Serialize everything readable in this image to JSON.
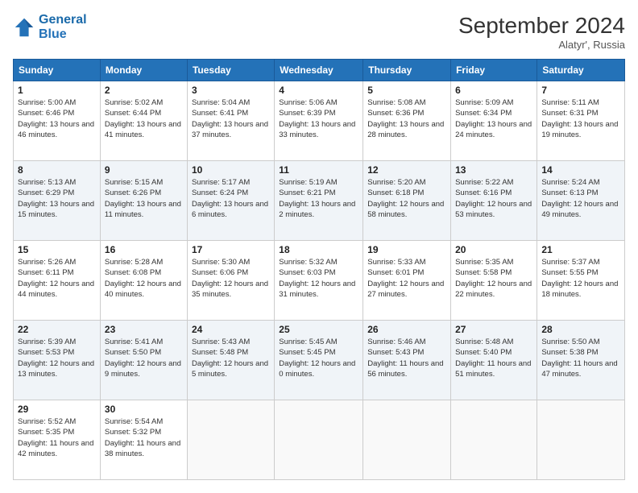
{
  "header": {
    "logo_line1": "General",
    "logo_line2": "Blue",
    "month_title": "September 2024",
    "subtitle": "Alatyr', Russia"
  },
  "weekdays": [
    "Sunday",
    "Monday",
    "Tuesday",
    "Wednesday",
    "Thursday",
    "Friday",
    "Saturday"
  ],
  "weeks": [
    [
      {
        "day": "1",
        "rise": "5:00 AM",
        "set": "6:46 PM",
        "daylight": "13 hours and 46 minutes."
      },
      {
        "day": "2",
        "rise": "5:02 AM",
        "set": "6:44 PM",
        "daylight": "13 hours and 41 minutes."
      },
      {
        "day": "3",
        "rise": "5:04 AM",
        "set": "6:41 PM",
        "daylight": "13 hours and 37 minutes."
      },
      {
        "day": "4",
        "rise": "5:06 AM",
        "set": "6:39 PM",
        "daylight": "13 hours and 33 minutes."
      },
      {
        "day": "5",
        "rise": "5:08 AM",
        "set": "6:36 PM",
        "daylight": "13 hours and 28 minutes."
      },
      {
        "day": "6",
        "rise": "5:09 AM",
        "set": "6:34 PM",
        "daylight": "13 hours and 24 minutes."
      },
      {
        "day": "7",
        "rise": "5:11 AM",
        "set": "6:31 PM",
        "daylight": "13 hours and 19 minutes."
      }
    ],
    [
      {
        "day": "8",
        "rise": "5:13 AM",
        "set": "6:29 PM",
        "daylight": "13 hours and 15 minutes."
      },
      {
        "day": "9",
        "rise": "5:15 AM",
        "set": "6:26 PM",
        "daylight": "13 hours and 11 minutes."
      },
      {
        "day": "10",
        "rise": "5:17 AM",
        "set": "6:24 PM",
        "daylight": "13 hours and 6 minutes."
      },
      {
        "day": "11",
        "rise": "5:19 AM",
        "set": "6:21 PM",
        "daylight": "13 hours and 2 minutes."
      },
      {
        "day": "12",
        "rise": "5:20 AM",
        "set": "6:18 PM",
        "daylight": "12 hours and 58 minutes."
      },
      {
        "day": "13",
        "rise": "5:22 AM",
        "set": "6:16 PM",
        "daylight": "12 hours and 53 minutes."
      },
      {
        "day": "14",
        "rise": "5:24 AM",
        "set": "6:13 PM",
        "daylight": "12 hours and 49 minutes."
      }
    ],
    [
      {
        "day": "15",
        "rise": "5:26 AM",
        "set": "6:11 PM",
        "daylight": "12 hours and 44 minutes."
      },
      {
        "day": "16",
        "rise": "5:28 AM",
        "set": "6:08 PM",
        "daylight": "12 hours and 40 minutes."
      },
      {
        "day": "17",
        "rise": "5:30 AM",
        "set": "6:06 PM",
        "daylight": "12 hours and 35 minutes."
      },
      {
        "day": "18",
        "rise": "5:32 AM",
        "set": "6:03 PM",
        "daylight": "12 hours and 31 minutes."
      },
      {
        "day": "19",
        "rise": "5:33 AM",
        "set": "6:01 PM",
        "daylight": "12 hours and 27 minutes."
      },
      {
        "day": "20",
        "rise": "5:35 AM",
        "set": "5:58 PM",
        "daylight": "12 hours and 22 minutes."
      },
      {
        "day": "21",
        "rise": "5:37 AM",
        "set": "5:55 PM",
        "daylight": "12 hours and 18 minutes."
      }
    ],
    [
      {
        "day": "22",
        "rise": "5:39 AM",
        "set": "5:53 PM",
        "daylight": "12 hours and 13 minutes."
      },
      {
        "day": "23",
        "rise": "5:41 AM",
        "set": "5:50 PM",
        "daylight": "12 hours and 9 minutes."
      },
      {
        "day": "24",
        "rise": "5:43 AM",
        "set": "5:48 PM",
        "daylight": "12 hours and 5 minutes."
      },
      {
        "day": "25",
        "rise": "5:45 AM",
        "set": "5:45 PM",
        "daylight": "12 hours and 0 minutes."
      },
      {
        "day": "26",
        "rise": "5:46 AM",
        "set": "5:43 PM",
        "daylight": "11 hours and 56 minutes."
      },
      {
        "day": "27",
        "rise": "5:48 AM",
        "set": "5:40 PM",
        "daylight": "11 hours and 51 minutes."
      },
      {
        "day": "28",
        "rise": "5:50 AM",
        "set": "5:38 PM",
        "daylight": "11 hours and 47 minutes."
      }
    ],
    [
      {
        "day": "29",
        "rise": "5:52 AM",
        "set": "5:35 PM",
        "daylight": "11 hours and 42 minutes."
      },
      {
        "day": "30",
        "rise": "5:54 AM",
        "set": "5:32 PM",
        "daylight": "11 hours and 38 minutes."
      },
      null,
      null,
      null,
      null,
      null
    ]
  ]
}
